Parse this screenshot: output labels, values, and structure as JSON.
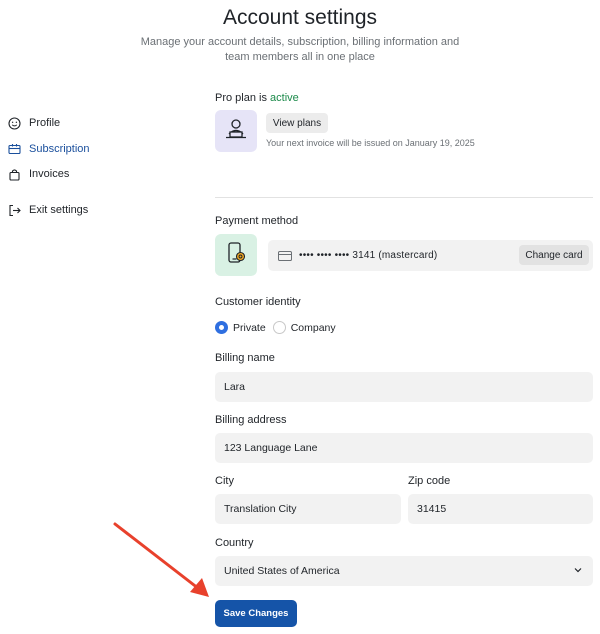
{
  "page": {
    "title": "Account settings",
    "subtitle": "Manage your account details, subscription, billing information and team members all in one place"
  },
  "sidebar": {
    "items": [
      {
        "label": "Profile",
        "icon": "smiley-icon",
        "active": false
      },
      {
        "label": "Subscription",
        "icon": "subscription-icon",
        "active": true
      },
      {
        "label": "Invoices",
        "icon": "bag-icon",
        "active": false
      },
      {
        "label": "Exit settings",
        "icon": "exit-icon",
        "active": false
      }
    ]
  },
  "plan": {
    "heading_prefix": "Pro plan is",
    "status": "active",
    "view_plans_label": "View plans",
    "invoice_note": "Your next invoice will be issued on January 19, 2025"
  },
  "payment": {
    "heading": "Payment method",
    "card_number": "•••• •••• •••• 3141  (mastercard)",
    "change_card_label": "Change card"
  },
  "identity": {
    "heading": "Customer identity",
    "options": [
      {
        "label": "Private",
        "checked": true
      },
      {
        "label": "Company",
        "checked": false
      }
    ]
  },
  "billing": {
    "name_label": "Billing name",
    "name_value": "Lara",
    "address_label": "Billing address",
    "address_value": "123 Language Lane",
    "city_label": "City",
    "city_value": "Translation City",
    "zip_label": "Zip code",
    "zip_value": "31415",
    "country_label": "Country",
    "country_value": "United States of America"
  },
  "actions": {
    "save_label": "Save Changes"
  },
  "colors": {
    "accent": "#1554a8",
    "active_green": "#1b8a4a",
    "annotation_arrow": "#e8412c",
    "radio_selected": "#2f6fe0"
  }
}
